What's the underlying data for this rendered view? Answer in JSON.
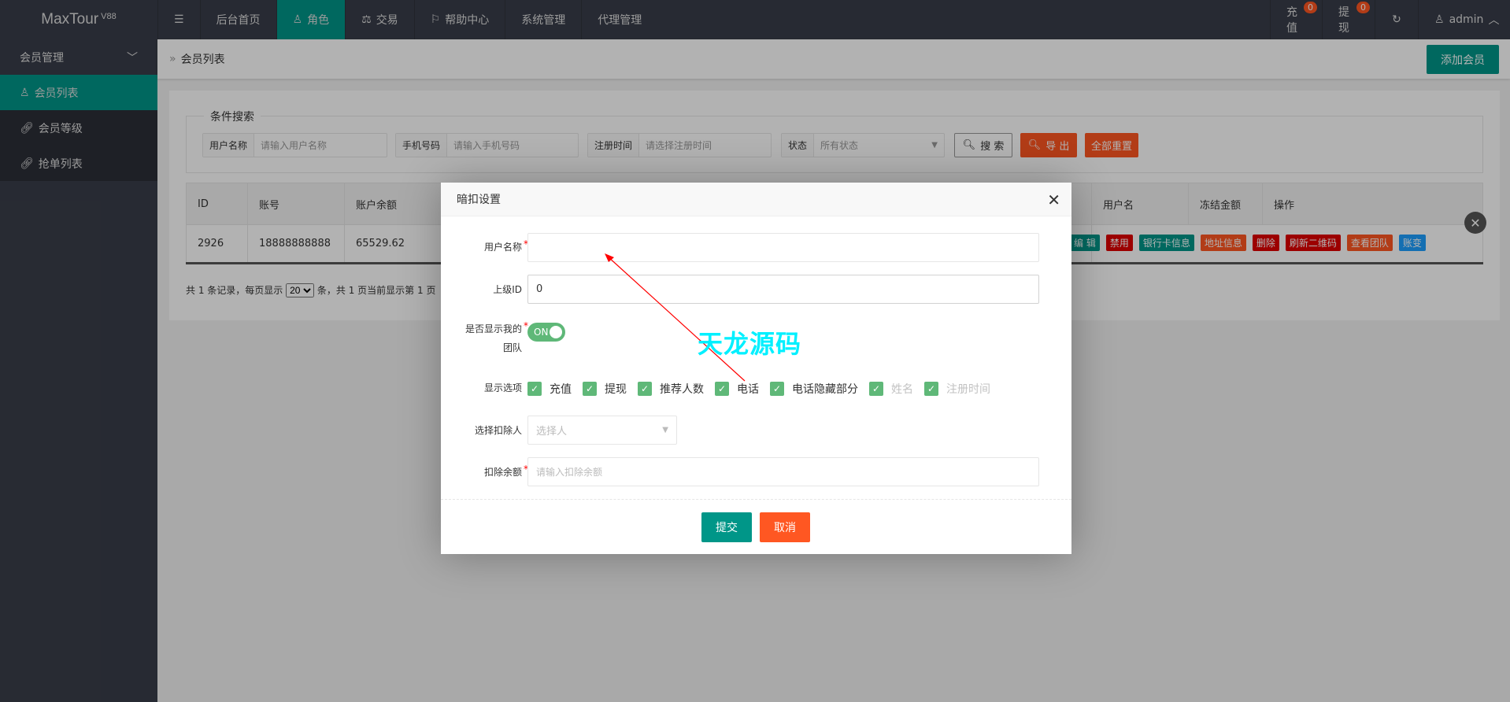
{
  "topbar": {
    "logo": "MaxTour",
    "version": "V88",
    "nav": [
      {
        "label": "后台首页"
      },
      {
        "label": "角色"
      },
      {
        "label": "交易"
      },
      {
        "label": "帮助中心"
      },
      {
        "label": "系统管理"
      },
      {
        "label": "代理管理"
      }
    ],
    "recharge": {
      "label": "充值",
      "count": "0"
    },
    "withdraw": {
      "label": "提现",
      "count": "0"
    },
    "user": "admin"
  },
  "sidebar": {
    "group": "会员管理",
    "items": [
      {
        "label": "会员列表"
      },
      {
        "label": "会员等级"
      },
      {
        "label": "抢单列表"
      }
    ]
  },
  "breadcrumb": "会员列表",
  "add_button": "添加会员",
  "search": {
    "legend": "条件搜索",
    "fields": [
      {
        "label": "用户名称",
        "placeholder": "请输入用户名称"
      },
      {
        "label": "手机号码",
        "placeholder": "请输入手机号码"
      },
      {
        "label": "注册时间",
        "placeholder": "请选择注册时间"
      },
      {
        "label": "状态",
        "value": "所有状态"
      }
    ],
    "search_btn": "搜 索",
    "export_btn": "导 出",
    "reset_btn": "全部重置"
  },
  "table": {
    "headers": [
      "ID",
      "账号",
      "账户余额",
      "用户名",
      "冻结金额",
      "操作"
    ],
    "rows": [
      {
        "id": "2926",
        "account": "18888888888",
        "balance": "65529.62"
      }
    ],
    "actions": [
      "编 辑",
      "禁用",
      "银行卡信息",
      "地址信息",
      "删除",
      "刷新二维码",
      "查看团队",
      "账变"
    ]
  },
  "pager": {
    "before": "共 1 条记录，每页显示",
    "size": "20",
    "after": "条，共 1 页当前显示第 1 页"
  },
  "modal": {
    "title": "暗扣设置",
    "username_label": "用户名称",
    "username_value": "",
    "parent_label": "上级ID",
    "parent_value": "0",
    "team_label": "是否显示我的团队",
    "team_toggle": "ON",
    "options_label": "显示选项",
    "options": [
      {
        "label": "充值",
        "checked": true
      },
      {
        "label": "提现",
        "checked": true
      },
      {
        "label": "推荐人数",
        "checked": true
      },
      {
        "label": "电话",
        "checked": true
      },
      {
        "label": "电话隐藏部分",
        "checked": true
      },
      {
        "label": "姓名",
        "checked": true
      },
      {
        "label": "注册时间",
        "checked": true
      }
    ],
    "deductor_label": "选择扣除人",
    "deductor_placeholder": "选择人",
    "amount_label": "扣除余额",
    "amount_placeholder": "请输入扣除余额",
    "submit": "提交",
    "cancel": "取消"
  },
  "watermark": "天龙源码",
  "colors": {
    "teal": "#009688",
    "orange": "#ff5722",
    "red": "#e00000",
    "blue": "#1e9fff",
    "green": "#5fb878"
  }
}
